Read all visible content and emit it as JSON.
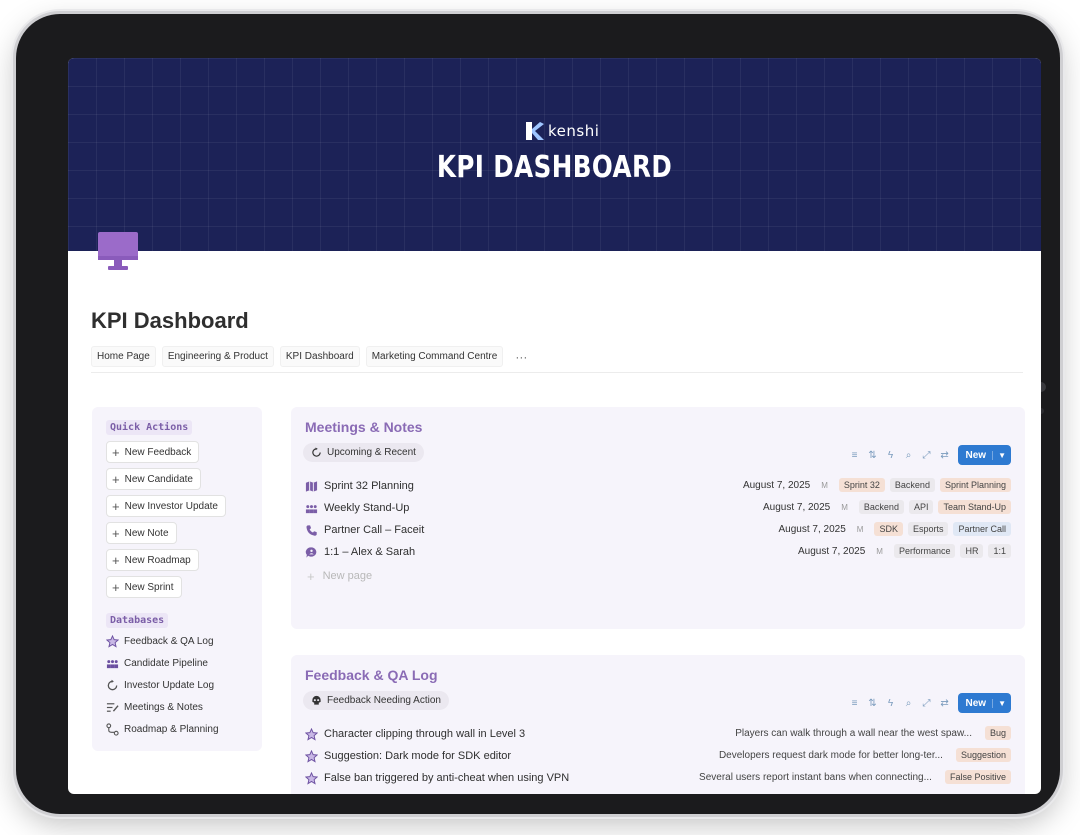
{
  "banner": {
    "brand": "kenshi",
    "title": "KPI DASHBOARD"
  },
  "page": {
    "title": "KPI Dashboard"
  },
  "breadcrumbs": [
    "Home Page",
    "Engineering & Product",
    "KPI Dashboard",
    "Marketing Command Centre"
  ],
  "breadcrumbs_more": "···",
  "sidebar": {
    "quick_actions_label": "Quick Actions",
    "quick_actions": [
      "New Feedback",
      "New Candidate",
      "New Investor Update",
      "New Note",
      "New Roadmap",
      "New Sprint"
    ],
    "databases_label": "Databases",
    "databases": [
      {
        "label": "Feedback & QA Log",
        "icon": "star-icon"
      },
      {
        "label": "Candidate Pipeline",
        "icon": "people-icon"
      },
      {
        "label": "Investor Update Log",
        "icon": "refresh-icon"
      },
      {
        "label": "Meetings & Notes",
        "icon": "notes-icon"
      },
      {
        "label": "Roadmap & Planning",
        "icon": "route-icon"
      }
    ]
  },
  "meetings": {
    "title": "Meetings & Notes",
    "view": "Upcoming & Recent",
    "new_label": "New",
    "new_page": "New page",
    "rows": [
      {
        "title": "Sprint 32 Planning",
        "icon": "map-icon",
        "date": "August 7, 2025",
        "meta": "M",
        "tags": [
          {
            "label": "Sprint 32",
            "color": "#f5e0d5"
          },
          {
            "label": "Backend",
            "color": "#ebe9ed"
          },
          {
            "label": "Sprint Planning",
            "color": "#f5e0d5"
          }
        ]
      },
      {
        "title": "Weekly Stand-Up",
        "icon": "people-icon",
        "date": "August 7, 2025",
        "meta": "M",
        "tags": [
          {
            "label": "Backend",
            "color": "#ebe9ed"
          },
          {
            "label": "API",
            "color": "#ebe9ed"
          },
          {
            "label": "Team Stand-Up",
            "color": "#f5e0d5"
          }
        ]
      },
      {
        "title": "Partner Call – Faceit",
        "icon": "phone-icon",
        "date": "August 7, 2025",
        "meta": "M",
        "tags": [
          {
            "label": "SDK",
            "color": "#f5e0d5"
          },
          {
            "label": "Esports",
            "color": "#ebe9ed"
          },
          {
            "label": "Partner Call",
            "color": "#e0e8f5"
          }
        ]
      },
      {
        "title": "1:1 – Alex & Sarah",
        "icon": "chat-icon",
        "date": "August 7, 2025",
        "meta": "M",
        "tags": [
          {
            "label": "Performance",
            "color": "#ebe9ed"
          },
          {
            "label": "HR",
            "color": "#ebe9ed"
          },
          {
            "label": "1:1",
            "color": "#ebe9ed"
          }
        ]
      }
    ]
  },
  "feedback": {
    "title": "Feedback & QA Log",
    "view": "Feedback Needing Action",
    "new_label": "New",
    "rows": [
      {
        "title": "Character clipping through wall in Level 3",
        "desc": "Players can walk through a wall near the west spaw...",
        "tag": {
          "label": "Bug",
          "color": "#f5e0d5"
        }
      },
      {
        "title": "Suggestion: Dark mode for SDK editor",
        "desc": "Developers request dark mode for better long-ter...",
        "tag": {
          "label": "Suggestion",
          "color": "#f5e0d5"
        }
      },
      {
        "title": "False ban triggered by anti-cheat when using VPN",
        "desc": "Several users report instant bans when connecting...",
        "tag": {
          "label": "False Positive",
          "color": "#f5e0d5"
        }
      }
    ]
  },
  "colors": {
    "banner": "#1c2257",
    "accent_purple": "#8a6bb5",
    "new_button": "#2e7ad1"
  }
}
